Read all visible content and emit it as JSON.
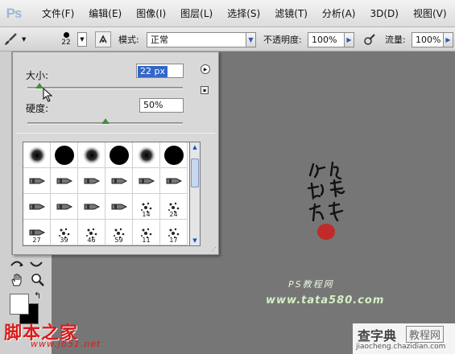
{
  "app": {
    "logo": "Ps"
  },
  "menu": [
    "文件(F)",
    "编辑(E)",
    "图像(I)",
    "图层(L)",
    "选择(S)",
    "滤镜(T)",
    "分析(A)",
    "3D(D)",
    "视图(V)"
  ],
  "options": {
    "brush_size_small": "22",
    "mode_label": "模式:",
    "mode_value": "正常",
    "opacity_label": "不透明度:",
    "opacity_value": "100%",
    "flow_label": "流量:",
    "flow_value": "100%"
  },
  "brush_panel": {
    "size_label": "大小:",
    "size_value": "22 px",
    "size_fraction": 0.08,
    "hardness_label": "硬度:",
    "hardness_value": "50%",
    "hardness_fraction": 0.5,
    "presets": [
      {
        "type": "soft",
        "num": ""
      },
      {
        "type": "hard",
        "num": ""
      },
      {
        "type": "soft",
        "num": ""
      },
      {
        "type": "hard",
        "num": ""
      },
      {
        "type": "soft",
        "num": ""
      },
      {
        "type": "hard",
        "num": ""
      },
      {
        "type": "tip",
        "num": ""
      },
      {
        "type": "tip",
        "num": ""
      },
      {
        "type": "tip",
        "num": ""
      },
      {
        "type": "tip",
        "num": ""
      },
      {
        "type": "tip",
        "num": ""
      },
      {
        "type": "tip",
        "num": ""
      },
      {
        "type": "tip",
        "num": ""
      },
      {
        "type": "tip",
        "num": ""
      },
      {
        "type": "tip",
        "num": ""
      },
      {
        "type": "tip",
        "num": ""
      },
      {
        "type": "splat",
        "num": "14"
      },
      {
        "type": "splat",
        "num": "24"
      },
      {
        "type": "tip",
        "num": "27"
      },
      {
        "type": "splat",
        "num": "39"
      },
      {
        "type": "splat",
        "num": "46"
      },
      {
        "type": "splat",
        "num": "59"
      },
      {
        "type": "splat",
        "num": "11"
      },
      {
        "type": "splat",
        "num": "17"
      }
    ]
  },
  "canvas": {
    "ps_caption": "PS教程网",
    "ps_url": "www.tata580.com"
  },
  "watermarks": {
    "left_logo": "脚本之家",
    "left_url": "www.jb51.net",
    "right_title": "查字典",
    "right_box": "教程网",
    "right_url": "jiaocheng.chazidian.com"
  },
  "colors": {
    "accent": "#2a57b3",
    "slider_thumb": "#3f8f3f",
    "selection": "#3267c8"
  }
}
